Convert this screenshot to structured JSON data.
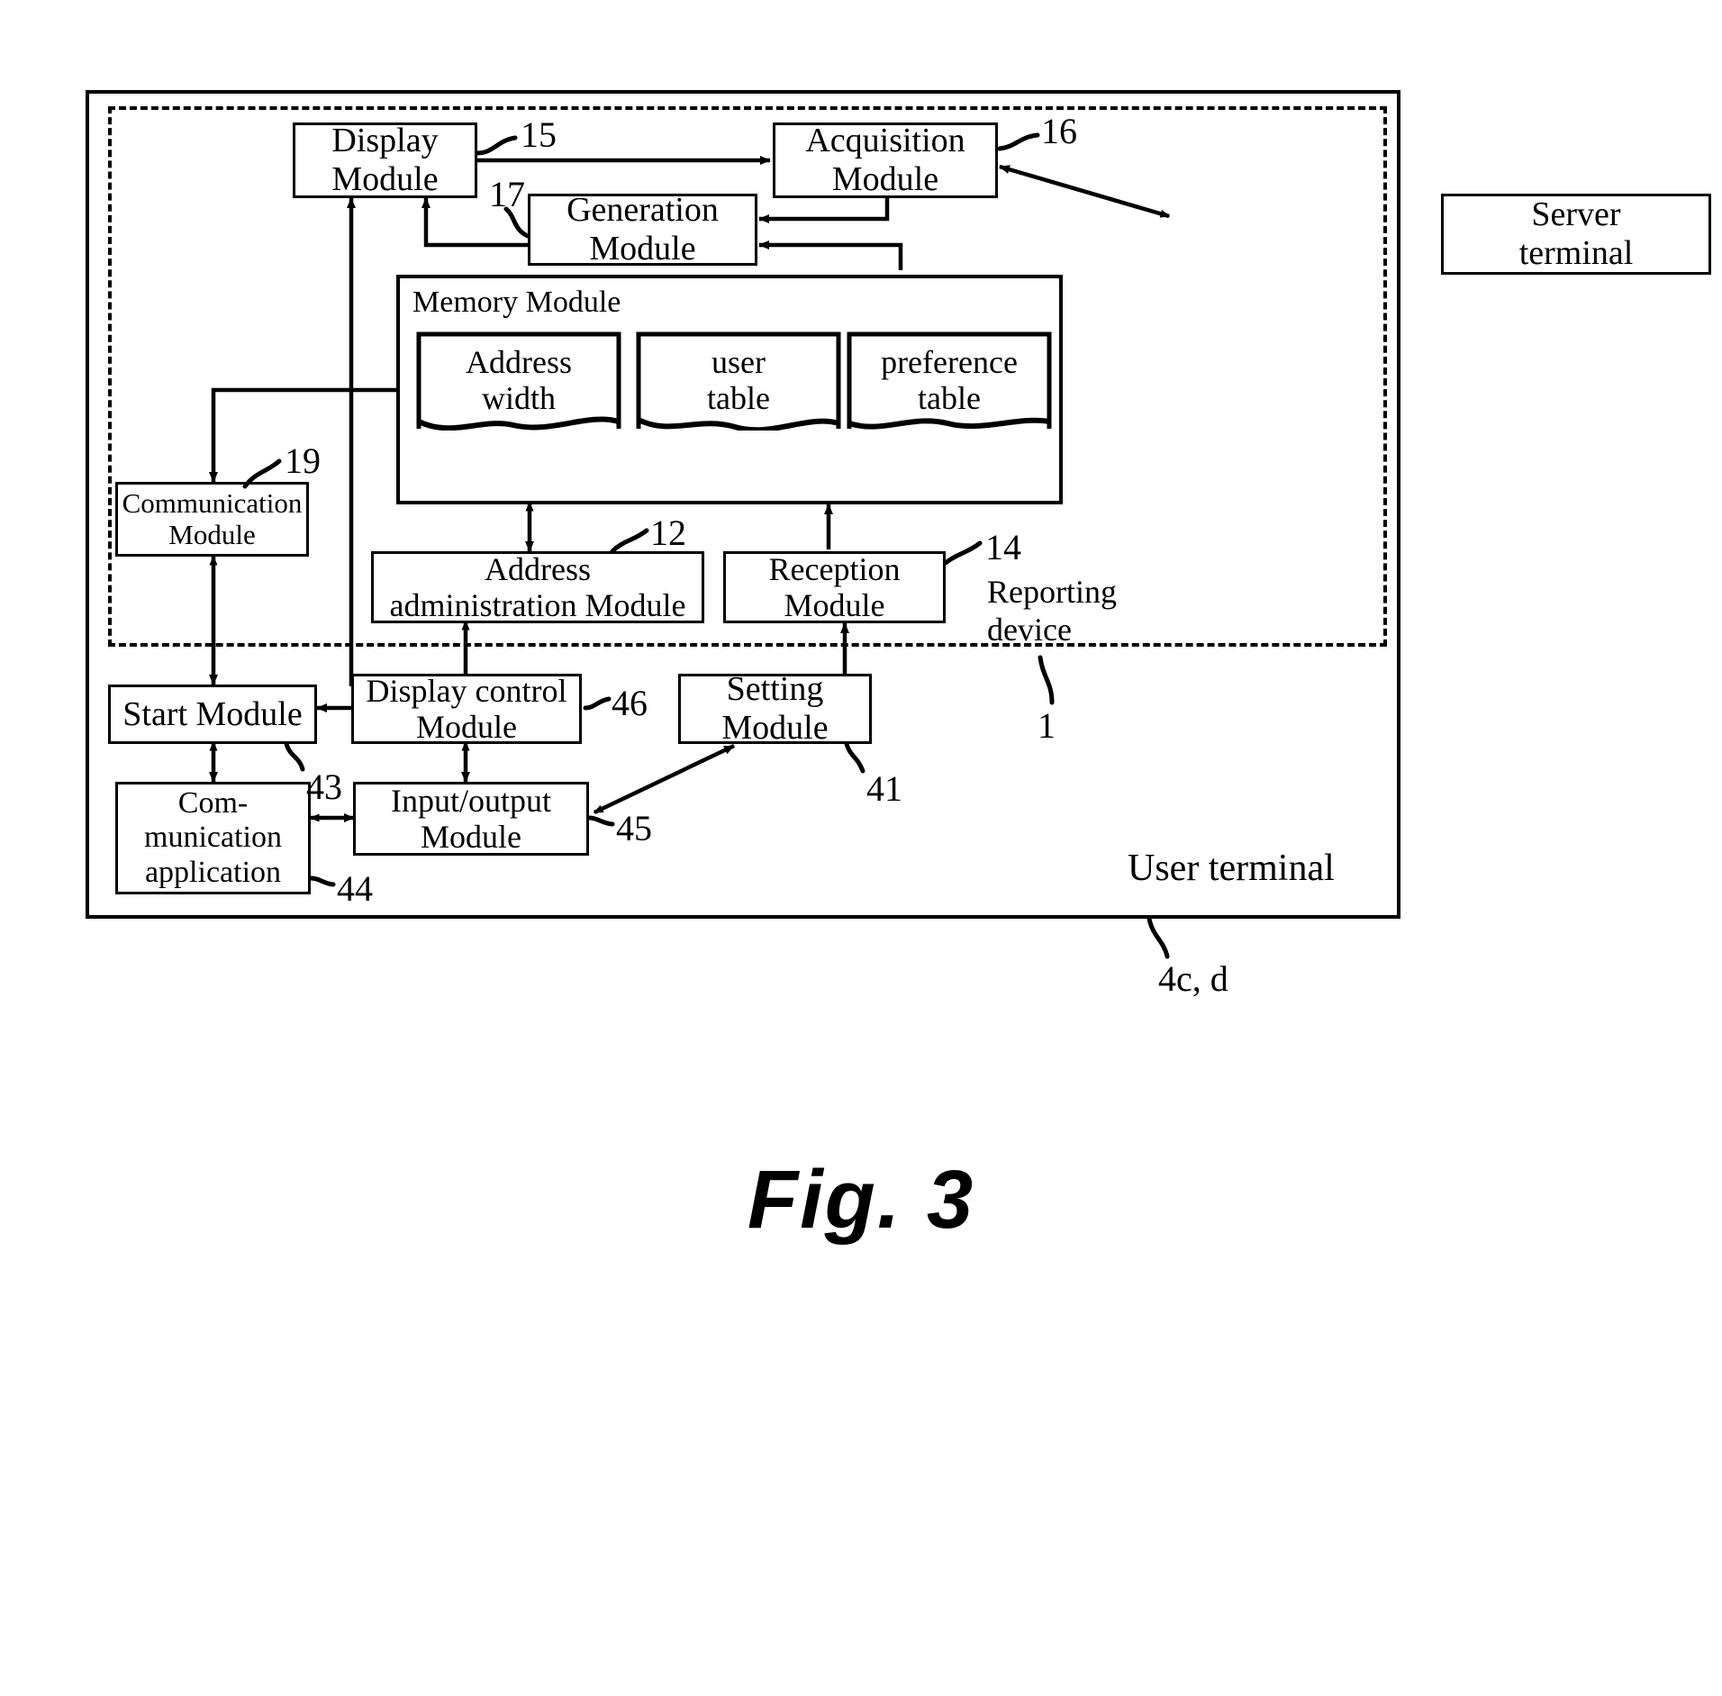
{
  "figure": {
    "caption": "Fig. 3"
  },
  "boundaries": {
    "outer_label": "User terminal",
    "outer_ref": "4c, d",
    "inner_label": "Reporting\ndevice",
    "inner_ref": "1"
  },
  "nodes": {
    "display_module": {
      "label": "Display\nModule",
      "ref": "15"
    },
    "acquisition_module": {
      "label": "Acquisition\nModule",
      "ref": "16"
    },
    "generation_module": {
      "label": "Generation\nModule",
      "ref": "17"
    },
    "server_terminal": {
      "label": "Server\nterminal",
      "ref": ""
    },
    "memory_module": {
      "label": "Memory Module",
      "ref": ""
    },
    "address_width": {
      "label": "Address\nwidth",
      "ref": ""
    },
    "user_table": {
      "label": "user\ntable",
      "ref": ""
    },
    "preference_table": {
      "label": "preference\ntable",
      "ref": ""
    },
    "communication_module": {
      "label": "Communication\nModule",
      "ref": "19"
    },
    "address_admin_module": {
      "label": "Address\nadministration Module",
      "ref": "12"
    },
    "reception_module": {
      "label": "Reception\nModule",
      "ref": "14"
    },
    "start_module": {
      "label": "Start Module",
      "ref": "43"
    },
    "display_control_module": {
      "label": "Display control\nModule",
      "ref": "46"
    },
    "setting_module": {
      "label": "Setting\nModule",
      "ref": "41"
    },
    "communication_app": {
      "label": "Com-\nmunication\napplication",
      "ref": "44"
    },
    "input_output_module": {
      "label": "Input/output\nModule",
      "ref": "45"
    }
  },
  "colors": {
    "stroke": "#000000",
    "background": "#ffffff"
  }
}
